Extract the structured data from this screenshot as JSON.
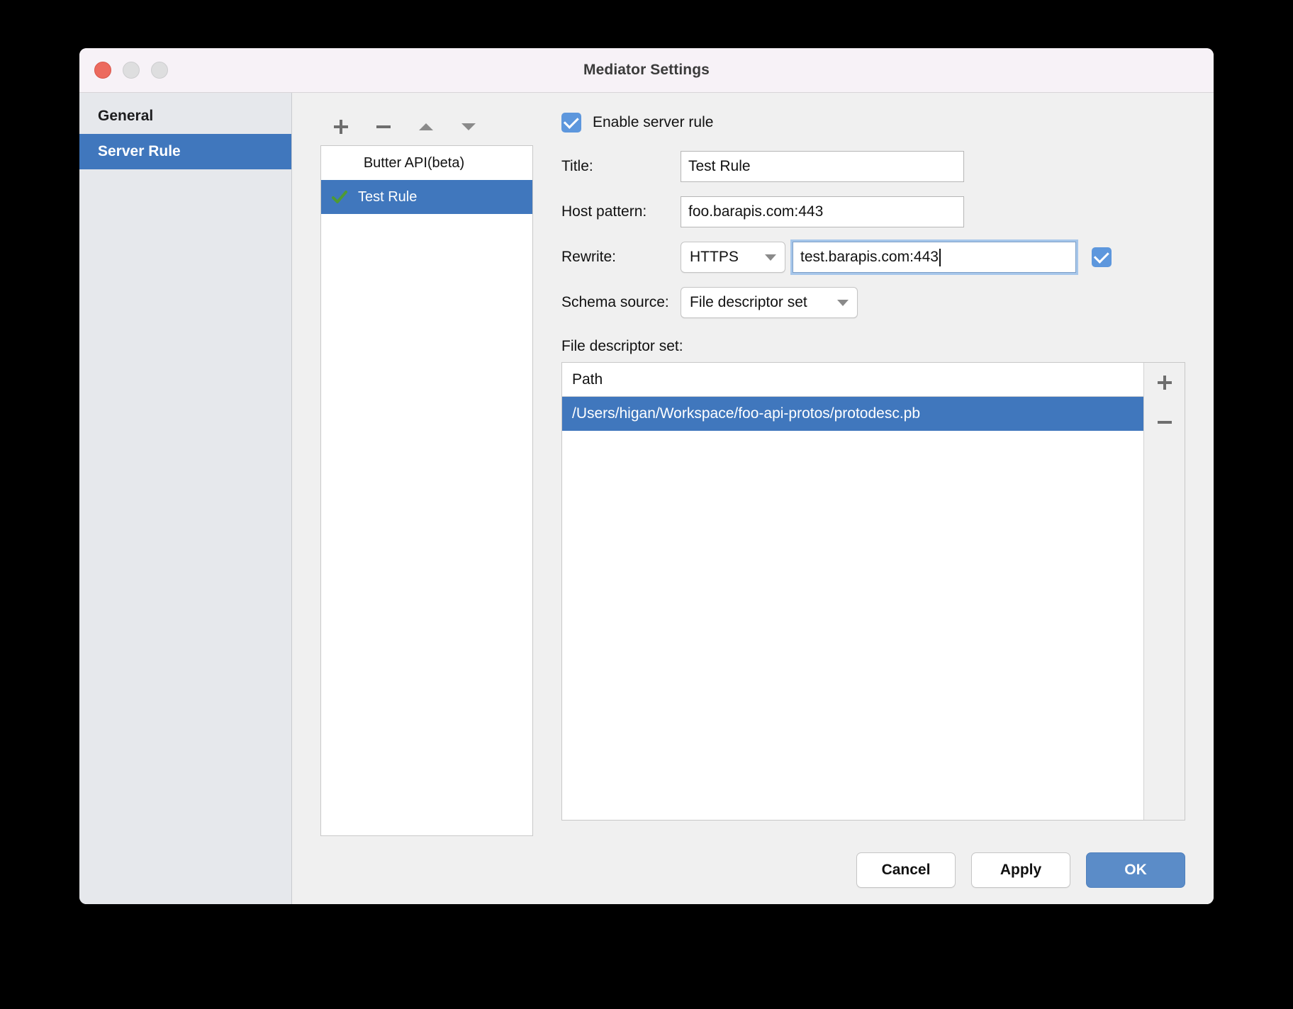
{
  "window": {
    "title": "Mediator Settings",
    "traffic_lights": [
      "close-button",
      "minimize-button",
      "maximize-button"
    ],
    "accent_blue": "#4077bd",
    "focus_blue": "#a6c6ea",
    "primary_button_blue": "#5b8cc8"
  },
  "sidebar": {
    "items": [
      {
        "label": "General",
        "selected": false
      },
      {
        "label": "Server Rule",
        "selected": true
      }
    ]
  },
  "rules_toolbar": {
    "add_label": "+",
    "remove_label": "−",
    "move_up_label": "▲",
    "move_down_label": "▼"
  },
  "rules_list": {
    "items": [
      {
        "label": "Butter API(beta)",
        "selected": false,
        "checked": false
      },
      {
        "label": "Test Rule",
        "selected": true,
        "checked": true
      }
    ]
  },
  "form": {
    "enable_checkbox": {
      "label": "Enable server rule",
      "checked": true
    },
    "title_field": {
      "label": "Title:",
      "value": "Test Rule"
    },
    "host_pattern_field": {
      "label": "Host pattern:",
      "value": "foo.barapis.com:443"
    },
    "rewrite": {
      "label": "Rewrite:",
      "protocol_value": "HTTPS",
      "host_value": "test.barapis.com:443",
      "enabled_checkbox_checked": true,
      "focused": true
    },
    "schema_source": {
      "label": "Schema source:",
      "value": "File descriptor set"
    },
    "file_descriptor_set": {
      "label": "File descriptor set:"
    }
  },
  "path_table": {
    "column_header": "Path",
    "rows": [
      {
        "path": "/Users/higan/Workspace/foo-api-protos/protodesc.pb",
        "selected": true
      }
    ],
    "add_label": "+",
    "remove_label": "−"
  },
  "footer": {
    "cancel_label": "Cancel",
    "apply_label": "Apply",
    "ok_label": "OK"
  }
}
